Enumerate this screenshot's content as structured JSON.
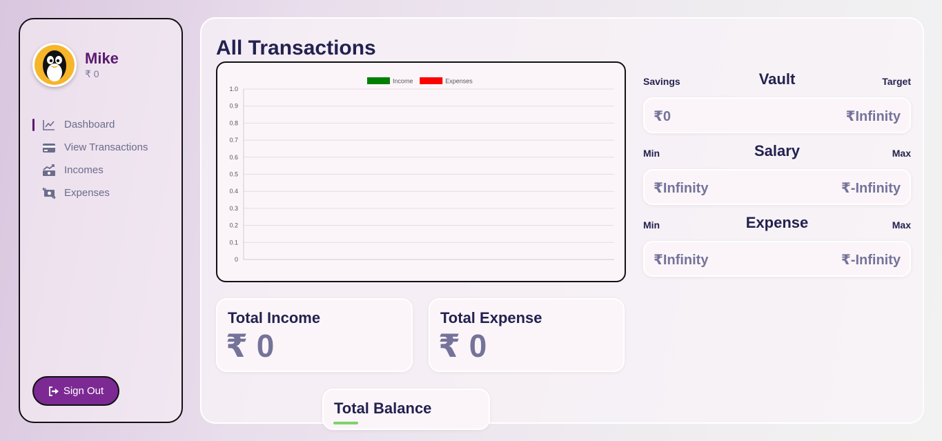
{
  "sidebar": {
    "user": {
      "name": "Mike",
      "balance": "₹ 0"
    },
    "items": [
      {
        "label": "Dashboard",
        "icon": "chart-line-icon",
        "active": true
      },
      {
        "label": "View Transactions",
        "icon": "credit-card-icon",
        "active": false
      },
      {
        "label": "Incomes",
        "icon": "money-trend-up-icon",
        "active": false
      },
      {
        "label": "Expenses",
        "icon": "money-transfer-icon",
        "active": false
      }
    ],
    "signout_label": "Sign Out"
  },
  "main": {
    "title": "All Transactions",
    "cards": {
      "income": {
        "title": "Total Income",
        "value": "₹ 0"
      },
      "expense": {
        "title": "Total Expense",
        "value": "₹ 0"
      },
      "balance": {
        "title": "Total Balance"
      }
    },
    "ranges": {
      "vault": {
        "title": "Vault",
        "left_label": "Savings",
        "right_label": "Target",
        "left_value": "₹0",
        "right_value": "₹Infinity"
      },
      "salary": {
        "title": "Salary",
        "left_label": "Min",
        "right_label": "Max",
        "left_value": "₹Infinity",
        "right_value": "₹-Infinity"
      },
      "expense": {
        "title": "Expense",
        "left_label": "Min",
        "right_label": "Max",
        "left_value": "₹Infinity",
        "right_value": "₹-Infinity"
      }
    }
  },
  "colors": {
    "income": "#008000",
    "expenses": "#ff0000",
    "accent": "#7c2994"
  },
  "chart_data": {
    "type": "line",
    "series": [
      {
        "name": "Income",
        "values": []
      },
      {
        "name": "Expenses",
        "values": []
      }
    ],
    "y_ticks": [
      "1.0",
      "0.9",
      "0.8",
      "0.7",
      "0.6",
      "0.5",
      "0.4",
      "0.3",
      "0.2",
      "0.1",
      "0"
    ],
    "ylim": [
      0,
      1
    ],
    "grid": true,
    "legend": "top-center"
  }
}
